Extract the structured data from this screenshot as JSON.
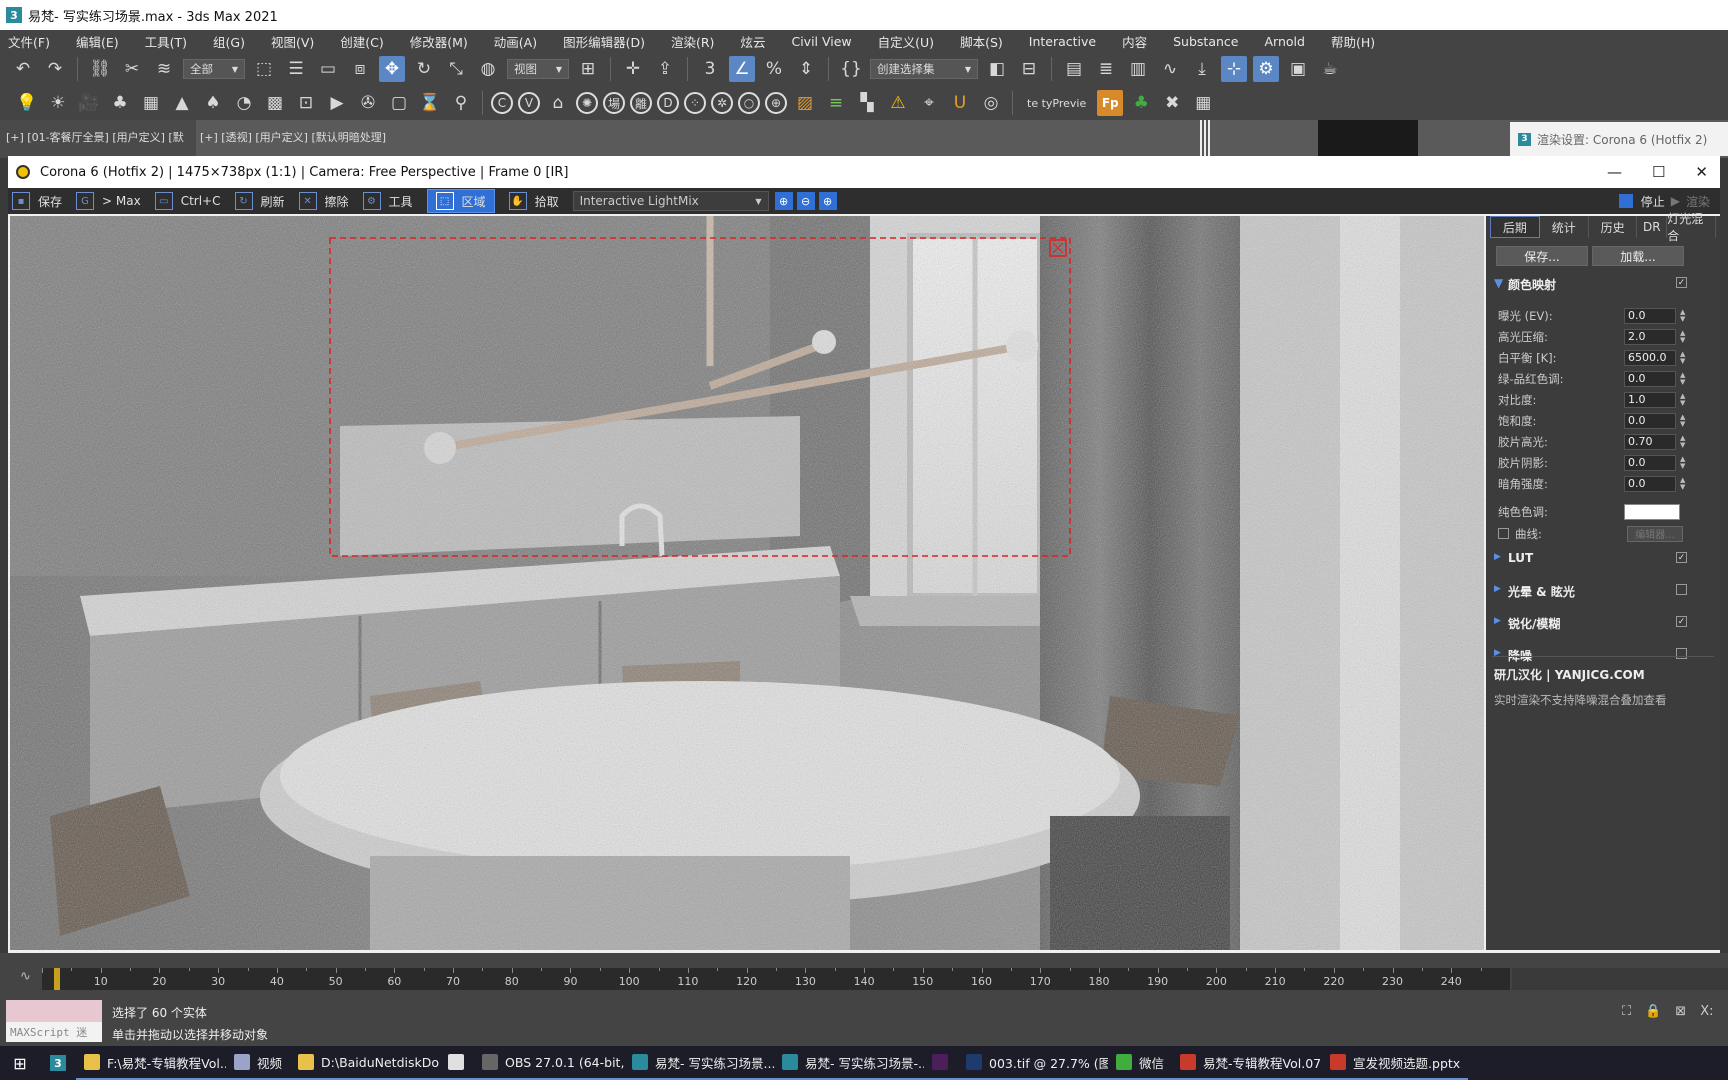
{
  "app": {
    "title": "易梵- 写实练习场景.max - 3ds Max 2021",
    "icon_label": "3"
  },
  "menubar": {
    "items": [
      "文件(F)",
      "编辑(E)",
      "工具(T)",
      "组(G)",
      "视图(V)",
      "创建(C)",
      "修改器(M)",
      "动画(A)",
      "图形编辑器(D)",
      "渲染(R)",
      "炫云",
      "Civil View",
      "自定义(U)",
      "脚本(S)",
      "Interactive",
      "内容",
      "Substance",
      "Arnold",
      "帮助(H)"
    ]
  },
  "toolbar1": {
    "selection_filter": "全部",
    "ref_coord": "视图",
    "named_selection": "创建选择集"
  },
  "toolbar2": {
    "preview_label": "te tyPrevie",
    "fp_label": "Fp"
  },
  "viewport_labels": {
    "left": "[+] [01-客餐厅全景] [用户定义] [默",
    "right": "[+] [透视] [用户定义] [默认明暗处理]",
    "render_settings": "渲染设置: Corona 6 (Hotfix 2)"
  },
  "frame_buffer": {
    "title": "Corona 6 (Hotfix 2) | 1475×738px (1:1) | Camera: Free Perspective | Frame 0 [IR]",
    "tools": {
      "save": "保存",
      "to_max": "> Max",
      "copy": "Ctrl+C",
      "refresh": "刷新",
      "clear": "擦除",
      "tools": "工具",
      "region": "区域",
      "pick": "拾取",
      "lightmix": "Interactive LightMix",
      "stop": "停止",
      "render": "渲染"
    },
    "panel": {
      "tabs": [
        "后期",
        "统计",
        "历史",
        "DR",
        "灯光混合"
      ],
      "save_btn": "保存...",
      "load_btn": "加载...",
      "tone_mapping": {
        "heading": "颜色映射",
        "rows": [
          {
            "label": "曝光 (EV):",
            "value": "0.0"
          },
          {
            "label": "高光压缩:",
            "value": "2.0"
          },
          {
            "label": "白平衡 [K]:",
            "value": "6500.0"
          },
          {
            "label": "绿-品红色调:",
            "value": "0.0"
          },
          {
            "label": "对比度:",
            "value": "1.0"
          },
          {
            "label": "饱和度:",
            "value": "0.0"
          },
          {
            "label": "胶片高光:",
            "value": "0.70"
          },
          {
            "label": "胶片阴影:",
            "value": "0.0"
          },
          {
            "label": "暗角强度:",
            "value": "0.0"
          }
        ],
        "tint_label": "纯色色调:",
        "curves_label": "曲线:",
        "editor_btn": "编辑器..."
      },
      "sections": [
        {
          "label": "LUT",
          "checked": true
        },
        {
          "label": "光晕 & 眩光",
          "checked": false
        },
        {
          "label": "锐化/模糊",
          "checked": true
        },
        {
          "label": "降噪",
          "checked": false
        }
      ],
      "brand": "研几汉化 | YANJICG.COM",
      "note": "实时渲染不支持降噪混合叠加查看"
    }
  },
  "timeline": {
    "ticks": [
      10,
      20,
      30,
      40,
      50,
      60,
      70,
      80,
      90,
      100,
      110,
      120,
      130,
      140,
      150,
      160,
      170,
      180,
      190,
      200,
      210,
      220,
      230,
      240
    ]
  },
  "status": {
    "selected": "选择了 60 个实体",
    "hint": "单击并拖动以选择并移动对象",
    "maxscript": "MAXScript 迷"
  },
  "taskbar": {
    "items": [
      {
        "label": "F:\\易梵-专辑教程Vol...",
        "color": "#e8c04a"
      },
      {
        "label": "视频",
        "color": "#9aa4c8"
      },
      {
        "label": "D:\\BaiduNetdiskDo...",
        "color": "#e8c04a"
      },
      {
        "label": "",
        "color": "#e0e0e0"
      },
      {
        "label": "OBS 27.0.1 (64-bit, ...",
        "color": "#666"
      },
      {
        "label": "易梵- 写实练习场景...",
        "color": "#2b8a9c"
      },
      {
        "label": "易梵- 写实练习场景-...",
        "color": "#2b8a9c"
      },
      {
        "label": "",
        "color": "#4a1f5a"
      },
      {
        "label": "003.tif @ 27.7% (图...",
        "color": "#1e3a6e"
      },
      {
        "label": "微信",
        "color": "#3fae3f"
      },
      {
        "label": "易梵-专辑教程Vol.07...",
        "color": "#c83b2a"
      },
      {
        "label": "宣发视频选题.pptx",
        "color": "#c83b2a"
      }
    ]
  }
}
